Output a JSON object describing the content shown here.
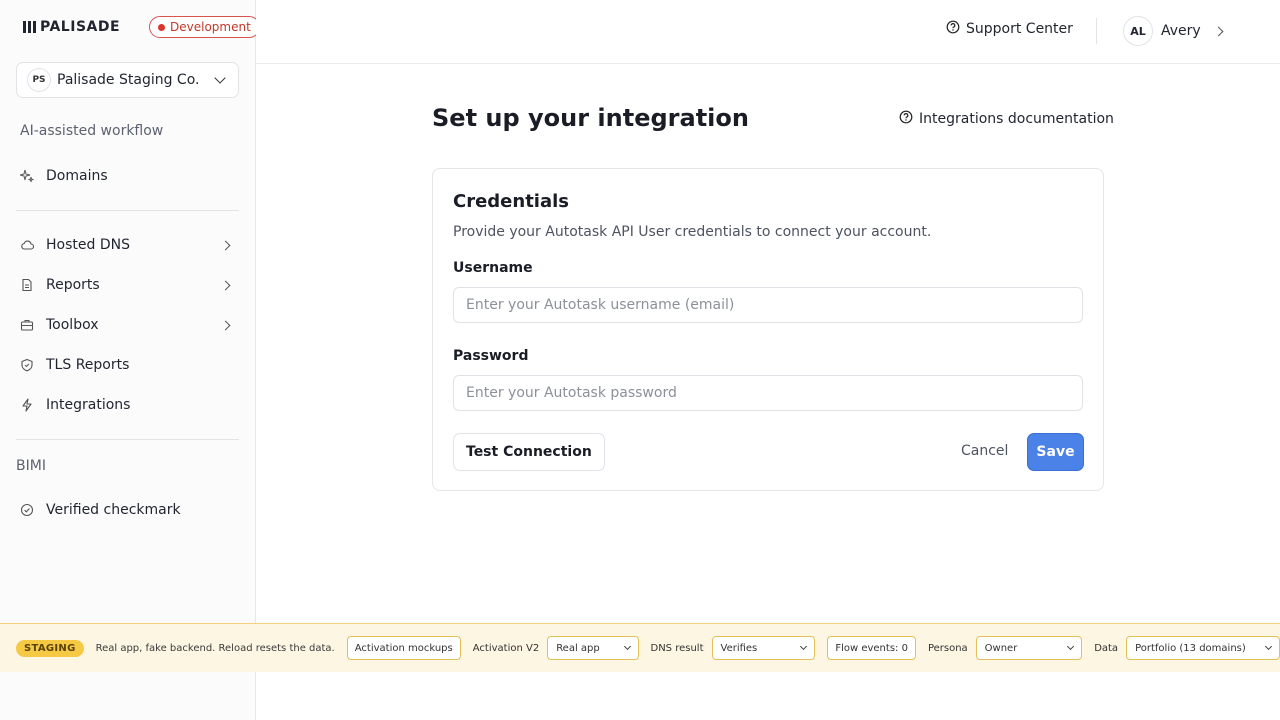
{
  "brand": {
    "name": "PALISADE",
    "env_badge": "Development"
  },
  "org": {
    "initials": "PS",
    "name": "Palisade Staging Co."
  },
  "sidebar": {
    "section_ai": "AI-assisted workflow",
    "section_bimi": "BIMI",
    "items": [
      {
        "label": "Domains",
        "icon": "sparkle-icon"
      },
      {
        "label": "Hosted DNS",
        "icon": "cloud-icon"
      },
      {
        "label": "Reports",
        "icon": "document-icon"
      },
      {
        "label": "Toolbox",
        "icon": "toolbox-icon"
      },
      {
        "label": "TLS Reports",
        "icon": "shield-icon"
      },
      {
        "label": "Integrations",
        "icon": "bolt-icon"
      },
      {
        "label": "Verified checkmark",
        "icon": "check-circle-icon"
      }
    ]
  },
  "header": {
    "support": "Support Center",
    "user_initials": "AL",
    "user_name": "Avery"
  },
  "main": {
    "title": "Set up your integration",
    "docs_link": "Integrations documentation",
    "card": {
      "title": "Credentials",
      "description": "Provide your Autotask API User credentials to connect your account.",
      "username_label": "Username",
      "username_placeholder": "Enter your Autotask username (email)",
      "password_label": "Password",
      "password_placeholder": "Enter your Autotask password",
      "test_button": "Test Connection",
      "cancel_button": "Cancel",
      "save_button": "Save"
    }
  },
  "staging": {
    "badge": "STAGING",
    "text": "Real app, fake backend. Reload resets the data.",
    "mockups_chip": "Activation mockups",
    "activation_label": "Activation V2",
    "activation_value": "Real app",
    "dns_label": "DNS result",
    "dns_value": "Verifies",
    "flow_chip": "Flow events: 0",
    "persona_label": "Persona",
    "persona_value": "Owner",
    "data_label": "Data",
    "data_value": "Portfolio (13 domains)"
  },
  "colors": {
    "accent": "#4a82e8",
    "badge_red": "#d9362f",
    "staging_yellow": "#f6c945"
  }
}
